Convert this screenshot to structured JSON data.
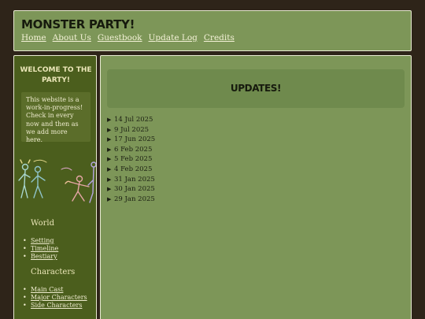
{
  "header": {
    "title": "MONSTER PARTY!",
    "nav": [
      "Home",
      "About Us",
      "Guestbook",
      "Update Log",
      "Credits"
    ]
  },
  "sidebar": {
    "welcome_title": "WELCOME TO THE PARTY!",
    "welcome_text": "This website is a work-in-progress! Check in every now and then as we add more here.",
    "sections": [
      {
        "heading": "World",
        "links": [
          "Setting",
          "Timeline",
          "Bestiary"
        ]
      },
      {
        "heading": "Characters",
        "links": [
          "Main Cast",
          "Major Characters",
          "Side Characters"
        ]
      }
    ]
  },
  "main": {
    "heading": "UPDATES!",
    "updates": [
      "14 Jul 2025",
      "9 Jul 2025",
      "17 Jun 2025",
      "6 Feb 2025",
      "5 Feb 2025",
      "4 Feb 2025",
      "31 Jan 2025",
      "30 Jan 2025",
      "29 Jan 2025"
    ]
  },
  "colors": {
    "page_bg": "#2e2419",
    "panel_green": "#7d9658",
    "sidebar_green": "#4b5e1d",
    "border": "#e9ead2"
  }
}
